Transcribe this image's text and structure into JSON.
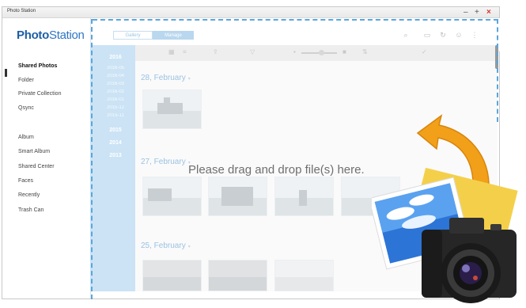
{
  "window": {
    "title": "Photo Station",
    "controls": {
      "minimize": "–",
      "maximize": "+",
      "close": "×"
    }
  },
  "brand": {
    "part1": "Photo",
    "part2": "Station"
  },
  "view_switch": {
    "left": "Gallery",
    "right": "Manage"
  },
  "nav": {
    "group1": [
      "Shared Photos",
      "Folder",
      "Private Collection",
      "Qsync"
    ],
    "group2": [
      "Album",
      "Smart Album",
      "Shared Center",
      "Faces",
      "Recently",
      "Trash Can"
    ]
  },
  "timeline": {
    "year1": "2016",
    "months": [
      "2016-05",
      "2016-04",
      "2016-03",
      "2016-02",
      "2016-01",
      "2015-12",
      "2015-11"
    ],
    "year2": "2015",
    "year3": "2014",
    "year4": "2013"
  },
  "groups": [
    {
      "date": "28, February"
    },
    {
      "date": "27, February"
    },
    {
      "date": "25, February"
    }
  ],
  "drop_message": "Please drag and drop file(s) here.",
  "colors": {
    "accent": "#2f76c4",
    "timeline": "#cbe3f5",
    "dashed_border": "#5aa6dd"
  },
  "icons": [
    "search-icon",
    "monitor-icon",
    "refresh-icon",
    "user-icon",
    "more-icon",
    "upload-arrow-icon",
    "photo-icon",
    "camera-icon"
  ]
}
